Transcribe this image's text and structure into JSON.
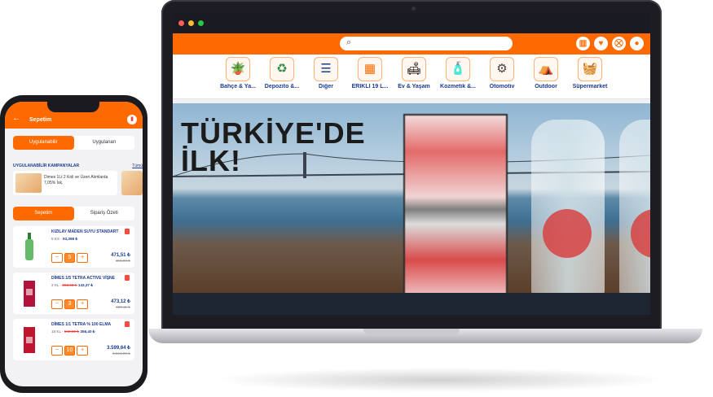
{
  "laptop": {
    "header": {
      "search_placeholder": "",
      "icons": [
        "store-icon",
        "heart-icon",
        "basket-icon",
        "user-icon"
      ]
    },
    "categories": [
      {
        "label": "Bahçe & Ya...",
        "icon": "garden-icon",
        "glyph": "🪴"
      },
      {
        "label": "Depozito &...",
        "icon": "recycle-icon",
        "glyph": "♻"
      },
      {
        "label": "Diğer",
        "icon": "list-icon",
        "glyph": "☰"
      },
      {
        "label": "ERİKLİ 19 L...",
        "icon": "grid-icon",
        "glyph": "▦"
      },
      {
        "label": "Ev & Yaşam",
        "icon": "home-icon",
        "glyph": "🛋"
      },
      {
        "label": "Kozmetik &...",
        "icon": "cosmetics-icon",
        "glyph": "🧴"
      },
      {
        "label": "Otomotiv",
        "icon": "car-icon",
        "glyph": "⚙"
      },
      {
        "label": "Outdoor",
        "icon": "tent-icon",
        "glyph": "⛺"
      },
      {
        "label": "Süpermarket",
        "icon": "basket-icon",
        "glyph": "🧺"
      }
    ],
    "banner": {
      "line1": "TÜRKİYE'DE",
      "line2": "İLK!"
    }
  },
  "phone": {
    "title": "Sepetim",
    "top_tabs": [
      "Uygulanabilir",
      "Uygulanan"
    ],
    "campaigns_title": "UYGULANABİLİR KAMPANYALAR",
    "campaigns_all": "Tümü",
    "campaign_text": "Dimes 1Lt 2 Koli ve Üzeri Alımlarda 7,05% İsk.",
    "cart_tabs": [
      "Sepetim",
      "Sipariş Özeti"
    ],
    "items": [
      {
        "name": "KIZILAY MADEN SUYU STANDART",
        "unit": "5 KS -",
        "old_unit": "",
        "unit_price": "93,368 ₺",
        "qty": "5",
        "total": "471,51 ₺",
        "old_total": "466,84 ₺",
        "color": "#4caf50"
      },
      {
        "name": "DİMES 1/5 TETRA ACTIVE VİŞNE",
        "unit": "3 KL -",
        "old_unit": "283,93 ₺",
        "unit_price": "143,37 ₺",
        "qty": "3",
        "total": "473,12 ₺",
        "old_total": "430,11 ₺",
        "color": "#b3123b"
      },
      {
        "name": "DİMES 1/1 TETRA % 100 ELMA",
        "unit": "18 KL -",
        "old_unit": "540,80 ₺",
        "unit_price": "356,40 ₺",
        "qty": "10",
        "total": "3.599,64 ₺",
        "old_total": "3.564,00 ₺",
        "color": "#c0152f"
      }
    ]
  }
}
